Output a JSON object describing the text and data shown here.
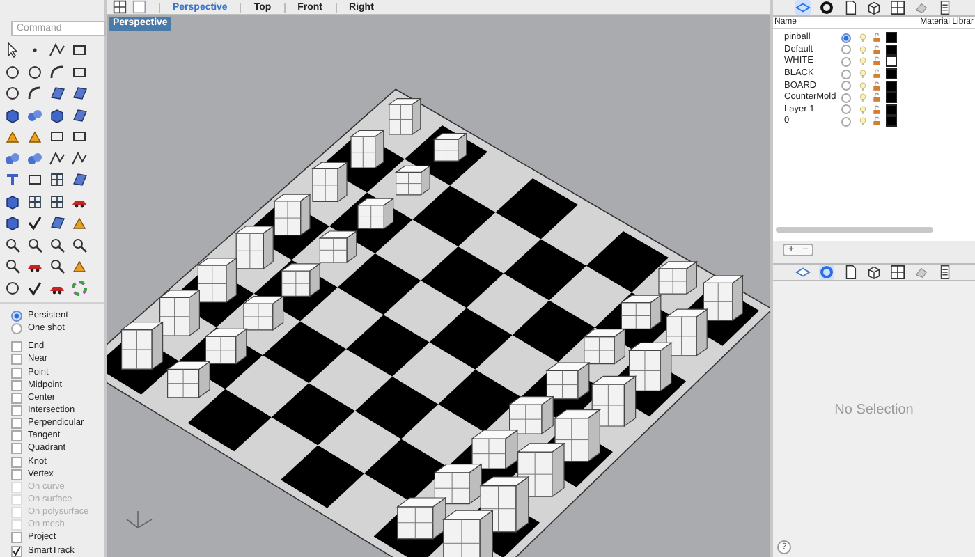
{
  "command_field": {
    "placeholder": "Command"
  },
  "osnap": {
    "modes": [
      {
        "label": "Persistent",
        "selected": true
      },
      {
        "label": "One shot",
        "selected": false
      }
    ],
    "snaps": [
      {
        "label": "End",
        "checked": false,
        "disabled": false
      },
      {
        "label": "Near",
        "checked": false,
        "disabled": false
      },
      {
        "label": "Point",
        "checked": false,
        "disabled": false
      },
      {
        "label": "Midpoint",
        "checked": false,
        "disabled": false
      },
      {
        "label": "Center",
        "checked": false,
        "disabled": false
      },
      {
        "label": "Intersection",
        "checked": false,
        "disabled": false
      },
      {
        "label": "Perpendicular",
        "checked": false,
        "disabled": false
      },
      {
        "label": "Tangent",
        "checked": false,
        "disabled": false
      },
      {
        "label": "Quadrant",
        "checked": false,
        "disabled": false
      },
      {
        "label": "Knot",
        "checked": false,
        "disabled": false
      },
      {
        "label": "Vertex",
        "checked": false,
        "disabled": false
      },
      {
        "label": "On curve",
        "checked": false,
        "disabled": true
      },
      {
        "label": "On surface",
        "checked": false,
        "disabled": true
      },
      {
        "label": "On polysurface",
        "checked": false,
        "disabled": true
      },
      {
        "label": "On mesh",
        "checked": false,
        "disabled": true
      },
      {
        "label": "Project",
        "checked": false,
        "disabled": false
      },
      {
        "label": "SmartTrack",
        "checked": true,
        "disabled": false
      }
    ]
  },
  "viewport_tabs": [
    {
      "label": "Perspective",
      "selected": true
    },
    {
      "label": "Top",
      "selected": false
    },
    {
      "label": "Front",
      "selected": false
    },
    {
      "label": "Right",
      "selected": false
    }
  ],
  "viewport": {
    "title": "Perspective"
  },
  "layers_panel": {
    "tabs": [
      {
        "selected": true
      },
      {
        "selected": false
      },
      {
        "selected": false
      },
      {
        "selected": false
      },
      {
        "selected": false
      },
      {
        "selected": false
      },
      {
        "selected": false
      }
    ],
    "columns": [
      "Name",
      "Material Librar"
    ],
    "layers": [
      {
        "name": "pinball",
        "current": true,
        "color": "#000000"
      },
      {
        "name": "Default",
        "current": false,
        "color": "#000000"
      },
      {
        "name": "WHITE",
        "current": false,
        "color": "#ffffff"
      },
      {
        "name": "BLACK",
        "current": false,
        "color": "#000000"
      },
      {
        "name": "BOARD",
        "current": false,
        "color": "#000000"
      },
      {
        "name": "CounterMold",
        "current": false,
        "color": "#000000"
      },
      {
        "name": "Layer 1",
        "current": false,
        "color": "#000000"
      },
      {
        "name": "0",
        "current": false,
        "color": "#000000"
      }
    ],
    "buttons": [
      "+",
      "−"
    ]
  },
  "properties_panel": {
    "tabs": [
      {
        "selected": false
      },
      {
        "selected": true
      },
      {
        "selected": false
      },
      {
        "selected": false
      },
      {
        "selected": false
      },
      {
        "selected": false
      },
      {
        "selected": false
      }
    ],
    "message": "No Selection",
    "help": "?"
  }
}
